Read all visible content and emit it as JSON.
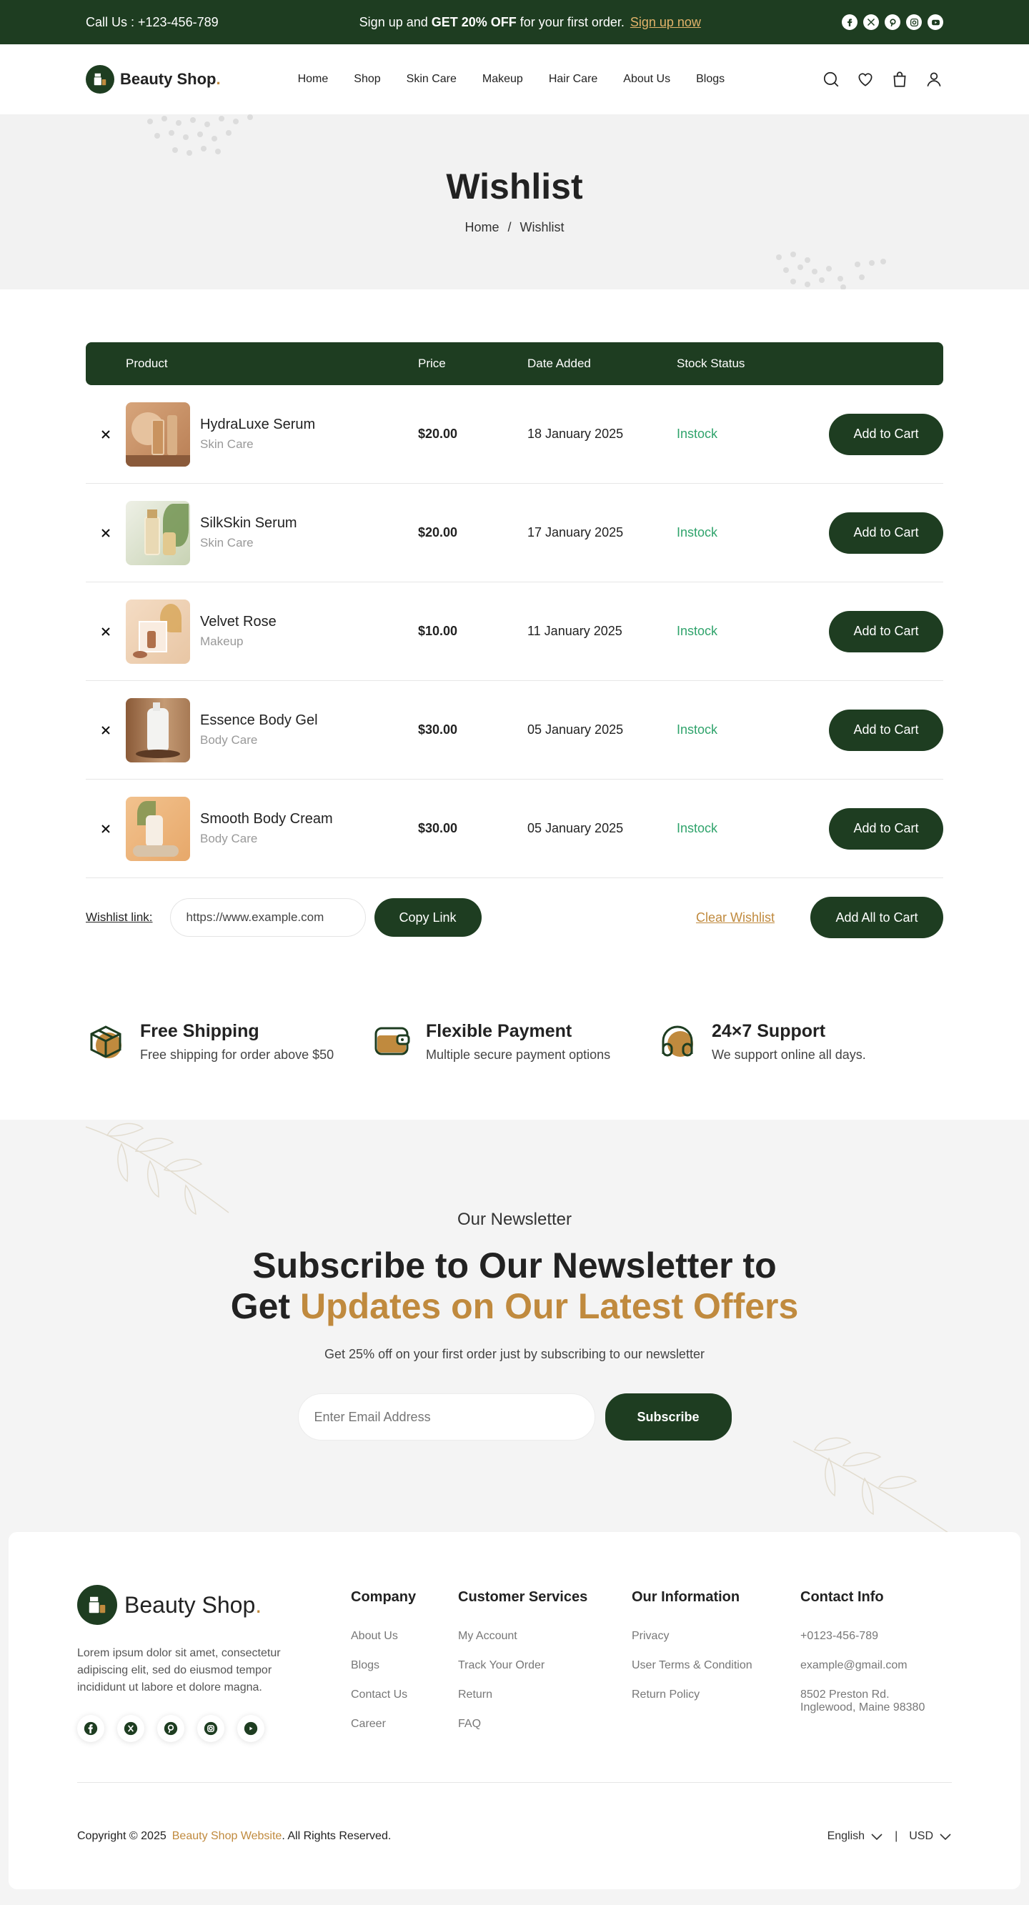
{
  "topbar": {
    "phone": "Call Us : +123-456-789",
    "promo_pre": "Sign up and ",
    "promo_bold": "GET 20% OFF",
    "promo_post": " for your first order.",
    "promo_link": "Sign up now",
    "social": [
      "facebook-icon",
      "x-icon",
      "pinterest-icon",
      "instagram-icon",
      "youtube-icon"
    ]
  },
  "brand": {
    "name": "Beauty Shop",
    "dot": "."
  },
  "nav": [
    "Home",
    "Shop",
    "Skin Care",
    "Makeup",
    "Hair Care",
    "About Us",
    "Blogs"
  ],
  "header_icons": [
    "search-icon",
    "heart-icon",
    "bag-icon",
    "user-icon"
  ],
  "hero": {
    "title": "Wishlist",
    "crumb_home": "Home",
    "crumb_sep": "/",
    "crumb_current": "Wishlist"
  },
  "table": {
    "headers": {
      "product": "Product",
      "price": "Price",
      "date": "Date Added",
      "stock": "Stock Status"
    },
    "rows": [
      {
        "name": "HydraLuxe Serum",
        "category": "Skin Care",
        "price": "$20.00",
        "date": "18 January 2025",
        "stock": "Instock",
        "button": "Add to Cart"
      },
      {
        "name": "SilkSkin Serum",
        "category": "Skin Care",
        "price": "$20.00",
        "date": "17 January 2025",
        "stock": "Instock",
        "button": "Add to Cart"
      },
      {
        "name": "Velvet Rose",
        "category": "Makeup",
        "price": "$10.00",
        "date": "11 January 2025",
        "stock": "Instock",
        "button": "Add to Cart"
      },
      {
        "name": "Essence Body Gel",
        "category": "Body Care",
        "price": "$30.00",
        "date": "05 January 2025",
        "stock": "Instock",
        "button": "Add to Cart"
      },
      {
        "name": "Smooth Body Cream",
        "category": "Body Care",
        "price": "$30.00",
        "date": "05 January 2025",
        "stock": "Instock",
        "button": "Add to Cart"
      }
    ]
  },
  "wishlist_actions": {
    "label": "Wishlist link:",
    "link_value": "https://www.example.com",
    "copy": "Copy Link",
    "clear": "Clear Wishlist",
    "add_all": "Add All to Cart"
  },
  "features": [
    {
      "title": "Free Shipping",
      "sub": "Free shipping for order above $50",
      "icon": "box-icon"
    },
    {
      "title": "Flexible Payment",
      "sub": "Multiple secure payment options",
      "icon": "wallet-icon"
    },
    {
      "title": "24×7 Support",
      "sub": "We support online all days.",
      "icon": "headset-icon"
    }
  ],
  "newsletter": {
    "kicker": "Our Newsletter",
    "title_line1": "Subscribe to Our Newsletter to",
    "title_pre": "Get ",
    "title_accent": "Updates on Our Latest Offers",
    "sub": "Get 25% off on your first order just by subscribing to our newsletter",
    "placeholder": "Enter Email Address",
    "button": "Subscribe"
  },
  "footer": {
    "desc": "Lorem ipsum dolor sit amet, consectetur adipiscing elit, sed do eiusmod tempor incididunt ut labore et dolore magna.",
    "columns": [
      {
        "title": "Company",
        "items": [
          "About Us",
          "Blogs",
          "Contact Us",
          "Career"
        ]
      },
      {
        "title": "Customer Services",
        "items": [
          "My Account",
          "Track Your Order",
          "Return",
          "FAQ"
        ]
      },
      {
        "title": "Our Information",
        "items": [
          "Privacy",
          "User Terms & Condition",
          "Return Policy"
        ]
      },
      {
        "title": "Contact Info",
        "items": [
          "+0123-456-789",
          "example@gmail.com",
          "8502 Preston Rd. Inglewood, Maine 98380"
        ]
      }
    ],
    "copyright_pre": "Copyright © 2025",
    "copyright_link": "Beauty Shop Website",
    "copyright_post": ". All Rights Reserved.",
    "language": "English",
    "currency": "USD",
    "divider": "|"
  },
  "colors": {
    "primary": "#1e3d21",
    "accent": "#c08a3e",
    "stock": "#2fa36b"
  }
}
